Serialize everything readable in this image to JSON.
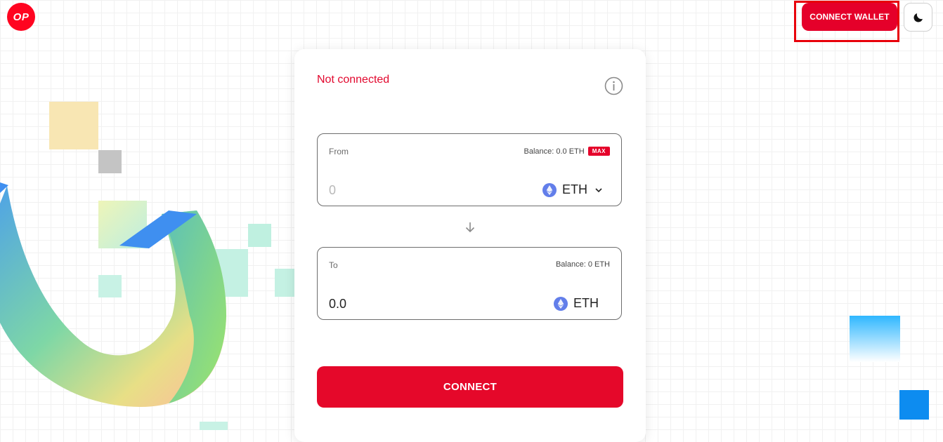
{
  "header": {
    "logo_text": "OP",
    "connect_wallet_label": "CONNECT WALLET",
    "theme_icon": "moon-icon"
  },
  "bridge": {
    "status": "Not connected",
    "info_icon": "info-icon",
    "from": {
      "label": "From",
      "balance": "Balance: 0.0 ETH",
      "max_label": "MAX",
      "amount_placeholder": "0",
      "token": "ETH",
      "token_icon": "ethereum-icon"
    },
    "swap_icon": "arrow-down-icon",
    "to": {
      "label": "To",
      "balance": "Balance: 0 ETH",
      "amount": "0.0",
      "token": "ETH",
      "token_icon": "ethereum-icon"
    },
    "connect_label": "CONNECT"
  },
  "colors": {
    "brand_red": "#e5002a",
    "status_red": "#e2082e",
    "eth_blue": "#627eea"
  }
}
